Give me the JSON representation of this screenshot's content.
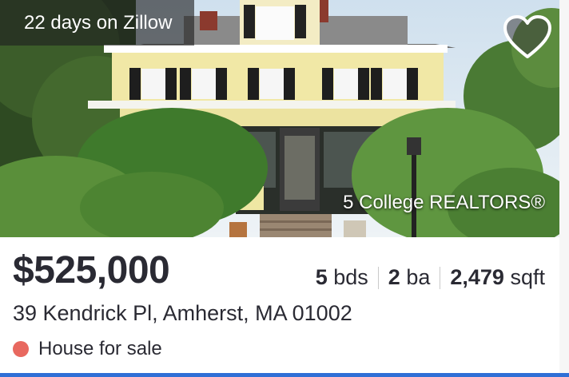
{
  "listing": {
    "days_on_market": "22 days on Zillow",
    "brokerage": "5 College REALTORS®",
    "price": "$525,000",
    "beds_value": "5",
    "beds_unit": "bds",
    "baths_value": "2",
    "baths_unit": "ba",
    "sqft_value": "2,479",
    "sqft_unit": "sqft",
    "address": "39 Kendrick Pl, Amherst, MA 01002",
    "status": "House for sale"
  },
  "icons": {
    "favorite": "heart-icon",
    "status": "status-dot"
  },
  "colors": {
    "status_dot": "#e8685f",
    "accent_bar": "#2f6fd6",
    "text": "#2a2a33"
  }
}
